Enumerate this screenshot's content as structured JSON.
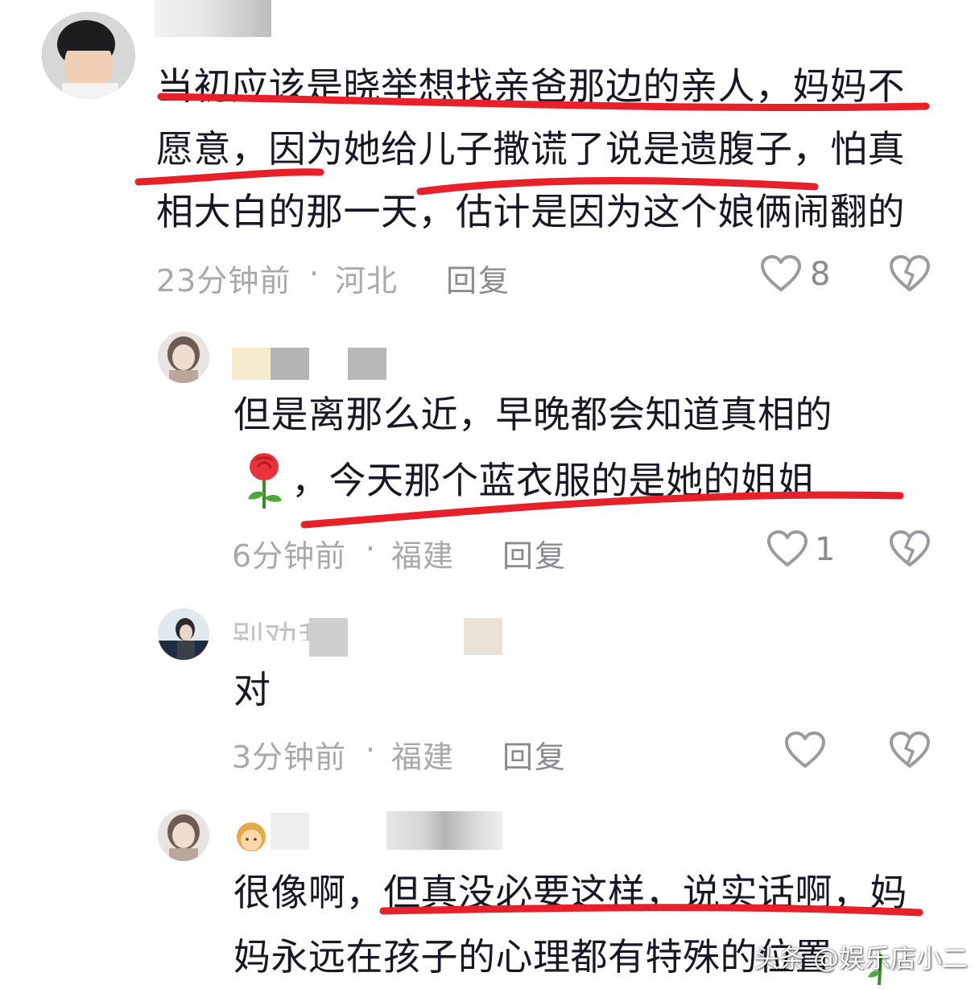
{
  "comments": [
    {
      "text_lines": [
        "当初应该是晓举想找亲爸那边的亲人，妈妈不",
        "愿意，因为她给儿子撒谎了说是遗腹子，怕真",
        "相大白的那一天，估计是因为这个娘俩闹翻的"
      ],
      "time": "23分钟前",
      "separator": "·",
      "location": "河北",
      "reply_label": "回复",
      "likes": "8"
    },
    {
      "text_lines": [
        "但是离那么近，早晚都会知道真相的",
        "，今天那个蓝衣服的是她的姐姐"
      ],
      "emoji": "rose",
      "time": "6分钟前",
      "separator": "·",
      "location": "福建",
      "reply_label": "回复",
      "likes": "1"
    },
    {
      "username_fragment": "别劝我",
      "text_lines": [
        "对"
      ],
      "time": "3分钟前",
      "separator": "·",
      "location": "福建",
      "reply_label": "回复",
      "likes": ""
    },
    {
      "text_lines": [
        "很像啊，但真没必要这样，说实话啊，妈",
        "妈永远在孩子的心理都有特殊的位置"
      ]
    }
  ],
  "watermark": "头条 @娱乐店小二",
  "colors": {
    "underline": "#e8202a",
    "meta": "#a8a8ad",
    "text": "#161823"
  },
  "icons": [
    "heart-outline-icon",
    "broken-heart-icon",
    "rose-emoji-icon"
  ]
}
